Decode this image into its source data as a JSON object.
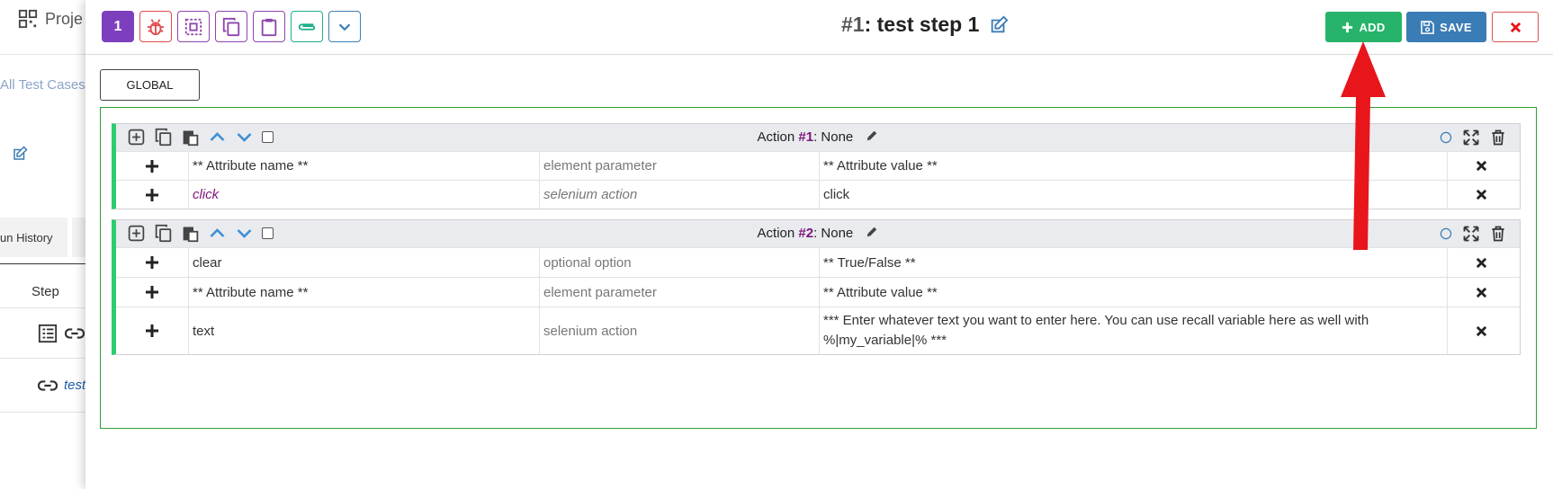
{
  "background": {
    "project_label": "Proje",
    "breadcrumb": "All Test Cases /",
    "tab_label": "un History",
    "column_step": "Step",
    "link_text": "test"
  },
  "toolbar": {
    "step_number": "1",
    "icons": [
      "bug-icon",
      "select-all-icon",
      "copy-icon",
      "paste-icon",
      "paperclip-icon",
      "chevron-down-icon"
    ]
  },
  "header": {
    "step_num": "#1",
    "step_title": ": test step 1",
    "add_label": "ADD",
    "save_label": "SAVE"
  },
  "global_label": "GLOBAL",
  "actions": [
    {
      "label": "Action ",
      "number": "#1",
      "name": ": None",
      "rows": [
        {
          "name": "** Attribute name **",
          "type": "element parameter",
          "value": "** Attribute value **"
        },
        {
          "name": "click",
          "type": "selenium action",
          "value": "click"
        }
      ]
    },
    {
      "label": "Action ",
      "number": "#2",
      "name": ": None",
      "rows": [
        {
          "name": "clear",
          "type": "optional option",
          "value": "** True/False **"
        },
        {
          "name": "** Attribute name **",
          "type": "element parameter",
          "value": "** Attribute value **"
        },
        {
          "name": "text",
          "type": "selenium action",
          "value": "*** Enter whatever text you want to enter here.  You can use recall variable here as well with %|my_variable|% ***"
        }
      ]
    }
  ],
  "colors": {
    "purple": "#7e3fbf",
    "green": "#27b46a",
    "blue": "#3a7cb5",
    "red": "#e8151b",
    "action_accent": "#2ecc71",
    "action_number": "#7e147a"
  }
}
